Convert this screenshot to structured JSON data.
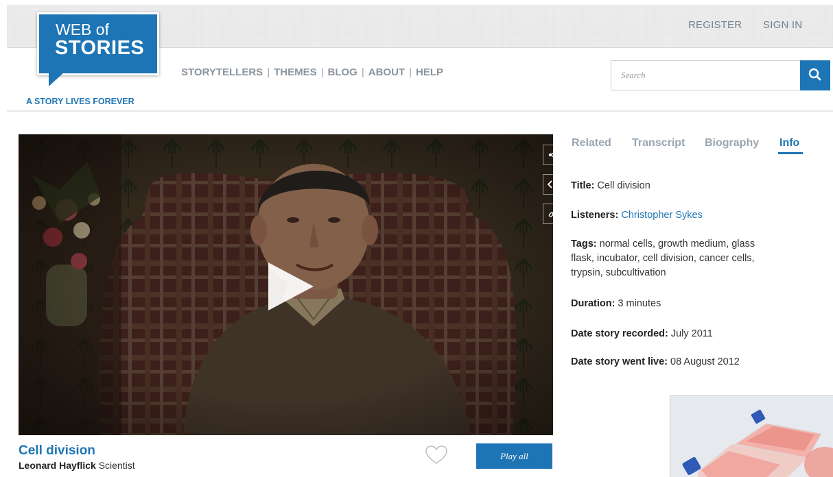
{
  "header": {
    "logo": {
      "line1": "WEB of",
      "line2": "STORIES"
    },
    "tagline": "A STORY LIVES FOREVER",
    "register_label": "REGISTER",
    "signin_label": "SIGN IN",
    "nav": [
      "STORYTELLERS",
      "THEMES",
      "BLOG",
      "ABOUT",
      "HELP"
    ],
    "nav_separator": "|",
    "search": {
      "placeholder": "Search"
    }
  },
  "video": {
    "title": "Cell division",
    "speaker_name": "Leonard Hayflick",
    "speaker_role": "Scientist",
    "play_all_label": "Play all"
  },
  "tabs": {
    "items": [
      "Related",
      "Transcript",
      "Biography",
      "Info"
    ],
    "active": "Info"
  },
  "info": {
    "title_label": "Title:",
    "title_value": "Cell division",
    "listeners_label": "Listeners:",
    "listeners_value": "Christopher Sykes",
    "tags_label": "Tags:",
    "tags_line1": "normal cells, growth medium, glass",
    "tags_line2": "flask, incubator, cell division, cancer cells,",
    "tags_line3": "trypsin, subcultivation",
    "duration_label": "Duration:",
    "duration_value": "3 minutes",
    "recorded_label": "Date story recorded:",
    "recorded_value": "July 2011",
    "live_label": "Date story went live:",
    "live_value": "08 August 2012"
  },
  "colors": {
    "brand_blue": "#1e75b5",
    "nav_gray": "#8b959f",
    "tab_inactive": "#99a5b0"
  },
  "icons": [
    "share-icon",
    "embed-icon",
    "link-icon",
    "play-icon",
    "heart-icon",
    "search-icon"
  ]
}
